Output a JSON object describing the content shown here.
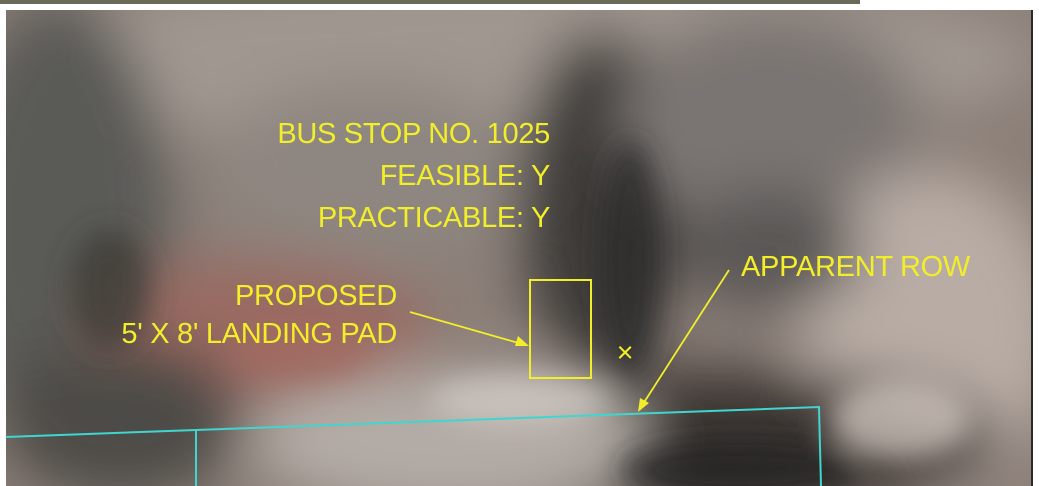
{
  "colors": {
    "annotation": "#f2ee2a",
    "right_of_way": "#3fd6d0",
    "imagery_base": "#8b7f78"
  },
  "bus_stop": {
    "line1": "BUS STOP NO. 1025",
    "line2": "FEASIBLE: Y",
    "line3": "PRACTICABLE: Y"
  },
  "landing_pad": {
    "line1": "PROPOSED",
    "line2": "5' X 8' LANDING PAD"
  },
  "row": {
    "label": "APPARENT ROW"
  },
  "marker": {
    "symbol": "×"
  }
}
